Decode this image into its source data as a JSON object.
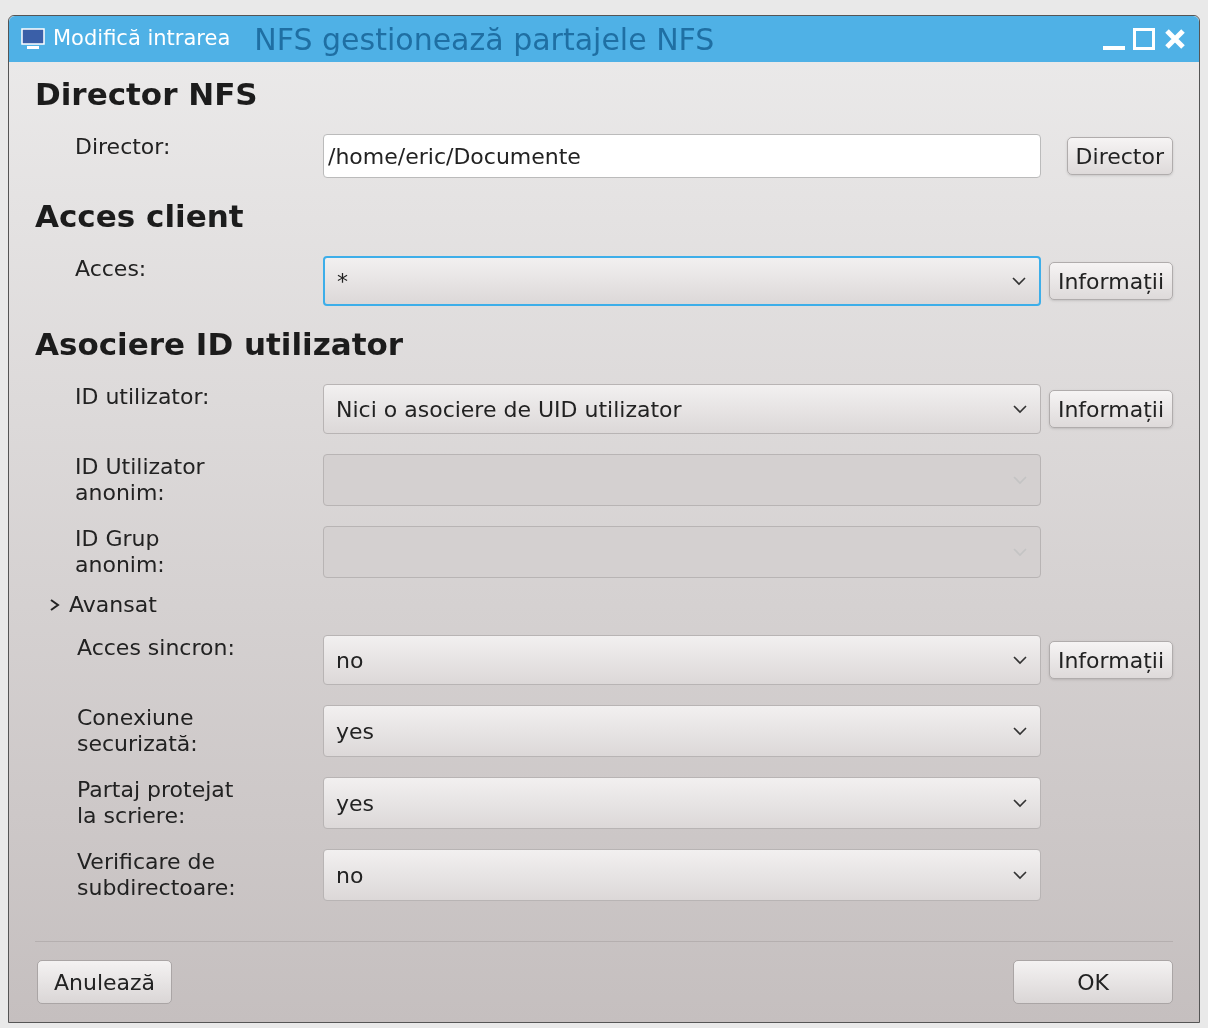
{
  "window": {
    "title": "Modifică intrarea",
    "background_title": "NFS gestionează partajele NFS"
  },
  "sections": [
    {
      "heading": "Director NFS",
      "rows": [
        {
          "label": "Director:",
          "kind": "text",
          "value": "/home/eric/Documente",
          "focused": false,
          "button": "Director"
        }
      ]
    },
    {
      "heading": "Acces client",
      "rows": [
        {
          "label": "Acces:",
          "kind": "select",
          "value": "*",
          "focused": true,
          "disabled": false,
          "button": "Informații"
        }
      ]
    },
    {
      "heading": "Asociere ID utilizator",
      "rows": [
        {
          "label": "ID utilizator:",
          "kind": "select",
          "value": "Nici o asociere de UID utilizator",
          "focused": false,
          "disabled": false,
          "button": "Informații"
        },
        {
          "label": "ID Utilizator anonim:",
          "kind": "select",
          "focused": false,
          "disabled": true
        },
        {
          "label": "ID Grup anonim:",
          "kind": "select",
          "focused": false,
          "disabled": true
        }
      ]
    }
  ],
  "advanced": {
    "label": "Avansat",
    "expanded": false,
    "rows": [
      {
        "label": "Acces sincron:",
        "kind": "select",
        "value": "no",
        "focused": false,
        "disabled": false,
        "button": "Informații"
      },
      {
        "label": "Conexiune securizată:",
        "kind": "select",
        "value": "yes",
        "focused": false,
        "disabled": false
      },
      {
        "label": "Partaj protejat la scriere:",
        "kind": "select",
        "value": "yes",
        "focused": false,
        "disabled": false
      },
      {
        "label": "Verificare de subdirectoare:",
        "kind": "select",
        "value": "no",
        "focused": false,
        "disabled": false
      }
    ]
  },
  "buttons": {
    "cancel": "Anulează",
    "ok": "OK"
  }
}
